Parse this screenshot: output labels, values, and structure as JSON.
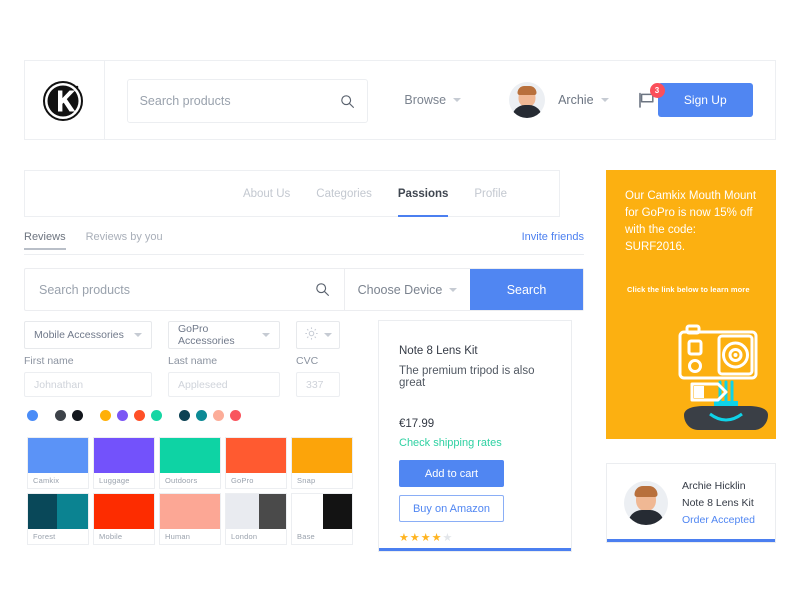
{
  "header": {
    "logo_alt": "Camkix logo",
    "search": {
      "placeholder": "Search products",
      "value": ""
    },
    "browse_label": "Browse",
    "user_name": "Archie",
    "notification_count": "3",
    "signup_label": "Sign Up"
  },
  "nav": {
    "tabs": [
      {
        "label": "About Us",
        "active": false
      },
      {
        "label": "Categories",
        "active": false
      },
      {
        "label": "Passions",
        "active": true
      },
      {
        "label": "Profile",
        "active": false
      }
    ]
  },
  "subnav": {
    "tabs": [
      {
        "label": "Reviews",
        "active": true
      },
      {
        "label": "Reviews by you",
        "active": false
      }
    ],
    "invite_label": "Invite friends"
  },
  "search_row": {
    "placeholder": "Search products",
    "value": "",
    "device_label": "Choose Device",
    "button_label": "Search"
  },
  "filters": {
    "category_1": "Mobile Accessories",
    "category_2": "GoPro Accessories",
    "settings_icon": "gear-icon"
  },
  "form": {
    "first_name": {
      "label": "First name",
      "placeholder": "Johnathan"
    },
    "last_name": {
      "label": "Last name",
      "placeholder": "Appleseed"
    },
    "cvc": {
      "label": "CVC",
      "placeholder": "337"
    }
  },
  "color_dots": [
    {
      "color": "#4a8cf7"
    },
    {
      "color": "#3d4249"
    },
    {
      "color": "#12161c"
    },
    {
      "color": "#ffb007"
    },
    {
      "color": "#7b56f5"
    },
    {
      "color": "#ff5027"
    },
    {
      "color": "#16d6a4"
    },
    {
      "color": "#0d4254"
    },
    {
      "color": "#0c8a95"
    },
    {
      "color": "#fcad99"
    },
    {
      "color": "#f9555e"
    }
  ],
  "swatches": [
    {
      "name": "Camkix",
      "left": "#5b93f7",
      "right": "#5b93f7",
      "split": 100
    },
    {
      "name": "Luggage",
      "left": "#7352fb",
      "right": "#7352fb",
      "split": 100
    },
    {
      "name": "Outdoors",
      "left": "#0ed3a4",
      "right": "#0ed3a4",
      "split": 100
    },
    {
      "name": "GoPro",
      "left": "#ff5a30",
      "right": "#ff5a30",
      "split": 100
    },
    {
      "name": "Snap",
      "left": "#fca40a",
      "right": "#fca40a",
      "split": 100
    },
    {
      "name": "Forest",
      "left": "#094859",
      "right": "#0b8391",
      "split": 48
    },
    {
      "name": "Mobile",
      "left": "#fd2c00",
      "right": "#fd2c00",
      "split": 100
    },
    {
      "name": "Human",
      "left": "#fca795",
      "right": "#fca795",
      "split": 100
    },
    {
      "name": "London",
      "left": "#e9ebf0",
      "right": "#4a4a4a",
      "split": 55
    },
    {
      "name": "Base",
      "left": "#ffffff",
      "right": "#131313",
      "split": 52
    }
  ],
  "product": {
    "title": "Note 8 Lens Kit",
    "subtitle": "The premium tripod is also great",
    "price": "€17.99",
    "shipping_link": "Check shipping rates",
    "cart_label": "Add to cart",
    "amazon_label": "Buy on Amazon",
    "rating": 4,
    "rating_max": 5
  },
  "promo": {
    "headline": "Our Camkix Mouth Mount for GoPro is now 15% off with the code: SURF2016.",
    "subline": "Click the link below to learn more",
    "illustration": "gopro-camera-icon",
    "background": "#fcb011"
  },
  "order": {
    "customer": "Archie Hicklin",
    "product": "Note 8 Lens Kit",
    "status": "Order Accepted"
  },
  "theme": {
    "accent_blue": "#5086f2",
    "accent_green": "#2ed1a2",
    "accent_orange": "#fcb011",
    "danger_red": "#fb4f5a",
    "star_gold": "#ffb420"
  }
}
